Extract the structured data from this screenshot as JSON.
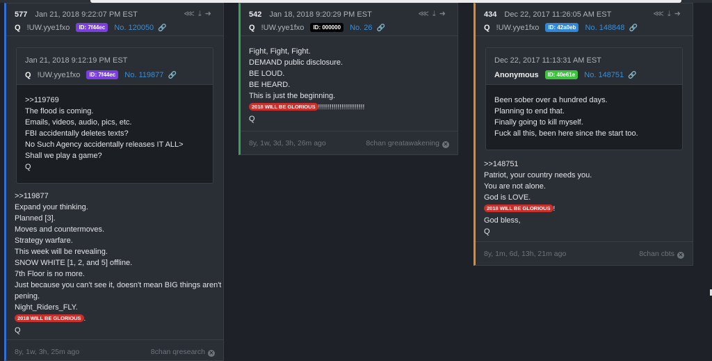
{
  "colors": {
    "accent_card1": "#2f6fd6",
    "accent_card2": "#3aa35a",
    "accent_card3": "#e08a2a",
    "id_purple": "#7b3fe0",
    "id_black": "#000000",
    "id_blue": "#2f87d6",
    "id_green": "#3cc43c",
    "glorious_red": "#c9302c"
  },
  "icons": [
    "share-icon",
    "download-icon",
    "arrow-right-circle-icon",
    "link-icon",
    "close-circle-icon"
  ],
  "posts": [
    {
      "number": "577",
      "date": "Jan 21, 2018 9:22:07 PM EST",
      "author": "Q",
      "trip": "!UW.yye1fxo",
      "id": "ID: 7f44ec",
      "post_no": "No. 120050",
      "quote": {
        "date": "Jan 21, 2018 9:12:19 PM EST",
        "author": "Q",
        "trip": "!UW.yye1fxo",
        "id": "ID: 7f44ec",
        "post_no": "No. 119877",
        "lines": [
          ">>119769",
          "The flood is coming.",
          "Emails, videos, audio, pics, etc.",
          "FBI accidentally deletes texts?",
          "No Such Agency accidentally releases IT ALL>",
          "Shall we play a game?",
          "Q"
        ]
      },
      "lines": [
        ">>119877",
        "Expand your thinking.",
        "Planned [3].",
        "Moves and countermoves.",
        "Strategy warfare.",
        "This week will be revealing.",
        "SNOW WHITE [1, 2, and 5] offline.",
        "7th Floor is no more.",
        "Just because you can't see it, doesn't mean BIG things aren't hap-",
        "pening.",
        "Night_Riders_FLY."
      ],
      "glorious": "2018 WILL BE GLORIOUS",
      "glorious_suffix": ".",
      "sign": "Q",
      "relative": "8y, 1w, 3h, 25m ago",
      "source": "8chan qresearch"
    },
    {
      "number": "542",
      "date": "Jan 18, 2018 9:20:29 PM EST",
      "author": "Q",
      "trip": "!UW.yye1fxo",
      "id": "ID: 000000",
      "post_no": "No. 26",
      "lines": [
        "Fight, Fight, Fight.",
        "DEMAND public disclosure.",
        "BE LOUD.",
        "BE HEARD.",
        "This is just the beginning."
      ],
      "glorious": "2018 WILL BE GLORIOUS",
      "glorious_suffix": "!!!!!!!!!!!!!!!!!!!!!!!!",
      "sign": "Q",
      "relative": "8y, 1w, 3d, 3h, 26m ago",
      "source": "8chan greatawakening"
    },
    {
      "number": "434",
      "date": "Dec 22, 2017 11:26:05 AM EST",
      "author": "Q",
      "trip": "!UW.yye1fxo",
      "id": "ID: 42a0eb",
      "post_no": "No. 148848",
      "quote": {
        "date": "Dec 22, 2017 11:13:31 AM EST",
        "author": "Anonymous",
        "id": "ID: 40e61e",
        "post_no": "No. 148751",
        "lines": [
          "Been sober over a hundred days.",
          "Planning to end that.",
          "Finally going to kill myself.",
          "Fuck all this, been here since the start too."
        ]
      },
      "lines": [
        ">>148751",
        "Patriot, your country needs you.",
        "You are not alone.",
        "God is LOVE."
      ],
      "glorious": "2018 WILL BE GLORIOUS",
      "glorious_suffix": "!",
      "lines_after": [
        "God bless,",
        "Q"
      ],
      "relative": "8y, 1m, 6d, 13h, 21m ago",
      "source": "8chan cbts"
    }
  ]
}
